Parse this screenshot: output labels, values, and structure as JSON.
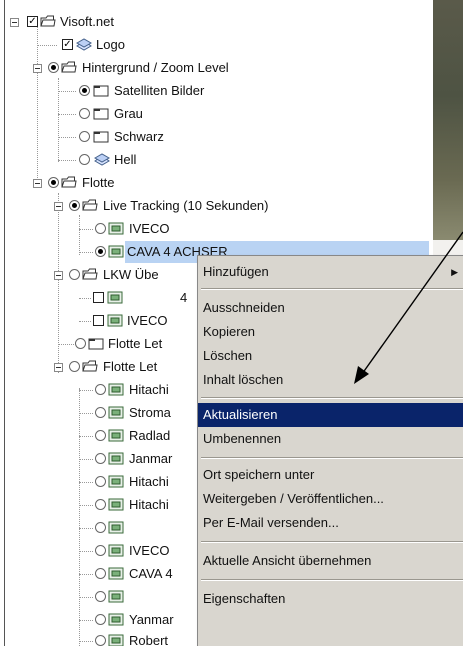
{
  "tree": {
    "items": [
      {
        "label": "Visoft.net"
      },
      {
        "label": "Logo"
      },
      {
        "label": "Hintergrund / Zoom Level"
      },
      {
        "label": "Satelliten Bilder"
      },
      {
        "label": "Grau"
      },
      {
        "label": "Schwarz"
      },
      {
        "label": "Hell"
      },
      {
        "label": "Flotte"
      },
      {
        "label": "Live Tracking (10 Sekunden)"
      },
      {
        "label": "IVECO"
      },
      {
        "label": "CAVA 4 ACHSER"
      },
      {
        "label": "LKW Übe"
      },
      {
        "label": "4"
      },
      {
        "label": "IVECO"
      },
      {
        "label": "Flotte Let"
      },
      {
        "label": "Flotte Let"
      },
      {
        "label": "Hitachi"
      },
      {
        "label": "Stroma"
      },
      {
        "label": "Radlad"
      },
      {
        "label": "Janmar"
      },
      {
        "label": "Hitachi"
      },
      {
        "label": "Hitachi"
      },
      {
        "label": ""
      },
      {
        "label": "IVECO"
      },
      {
        "label": "CAVA 4"
      },
      {
        "label": ""
      },
      {
        "label": "Yanmar"
      },
      {
        "label": "Robert"
      }
    ]
  },
  "context_menu": {
    "items": [
      {
        "label": "Hinzufügen"
      },
      {
        "label": "Ausschneiden"
      },
      {
        "label": "Kopieren"
      },
      {
        "label": "Löschen"
      },
      {
        "label": "Inhalt löschen"
      },
      {
        "label": "Aktualisieren"
      },
      {
        "label": "Umbenennen"
      },
      {
        "label": "Ort speichern unter"
      },
      {
        "label": "Weitergeben / Veröffentlichen..."
      },
      {
        "label": "Per E-Mail versenden..."
      },
      {
        "label": "Aktuelle Ansicht übernehmen"
      },
      {
        "label": "Eigenschaften"
      }
    ],
    "highlighted": "Aktualisieren"
  },
  "icons": {
    "folder": "folder-icon",
    "layer": "layer-icon",
    "vehicle": "vehicle-icon"
  }
}
